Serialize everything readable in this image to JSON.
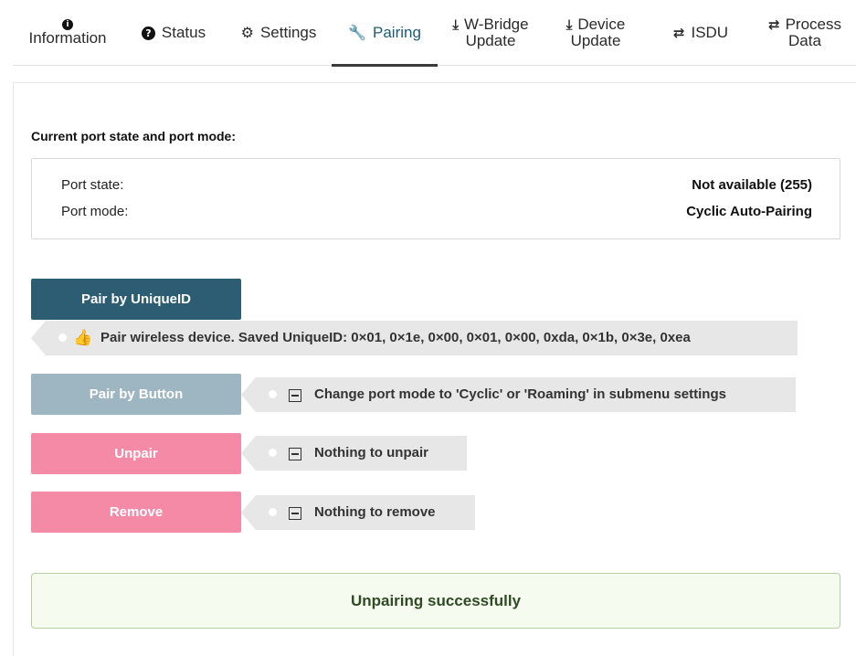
{
  "tabs": [
    {
      "id": "information",
      "icon": "info-icon",
      "label": "Information"
    },
    {
      "id": "status",
      "icon": "question-icon",
      "label": "Status"
    },
    {
      "id": "settings",
      "icon": "gear-icon",
      "label": "Settings"
    },
    {
      "id": "pairing",
      "icon": "wrench-icon",
      "label": "Pairing",
      "active": true
    },
    {
      "id": "wbridge",
      "icon": "download-icon",
      "line1": "W-Bridge",
      "line2": "Update"
    },
    {
      "id": "device",
      "icon": "download-icon",
      "line1": "Device",
      "line2": "Update"
    },
    {
      "id": "isdu",
      "icon": "exchange-icon",
      "label": "ISDU"
    },
    {
      "id": "process",
      "icon": "exchange-icon",
      "line1": "Process",
      "line2": "Data"
    }
  ],
  "port": {
    "title": "Current port state and port mode:",
    "state_label": "Port state:",
    "state_value": "Not available (255)",
    "mode_label": "Port mode:",
    "mode_value": "Cyclic Auto-Pairing"
  },
  "actions": {
    "pair_uid": {
      "label": "Pair by UniqueID",
      "info": "Pair wireless device. Saved UniqueID: 0×01, 0×1e, 0×00, 0×01, 0×00, 0xda, 0×1b, 0×3e, 0xea",
      "info_icon": "thumbs-up-icon"
    },
    "pair_button": {
      "label": "Pair by Button",
      "info": "Change port mode to 'Cyclic' or 'Roaming' in submenu settings",
      "info_icon": "minus-box-icon"
    },
    "unpair": {
      "label": "Unpair",
      "info": "Nothing to unpair",
      "info_icon": "minus-box-icon"
    },
    "remove": {
      "label": "Remove",
      "info": "Nothing to remove",
      "info_icon": "minus-box-icon"
    }
  },
  "colors": {
    "primary": "#2c5d73",
    "disabled": "#9eb6c1",
    "danger": "#f48aa6",
    "success_bg": "#f6fbef",
    "success_border": "#b7d0a2"
  },
  "message": {
    "success": "Unpairing successfully"
  }
}
